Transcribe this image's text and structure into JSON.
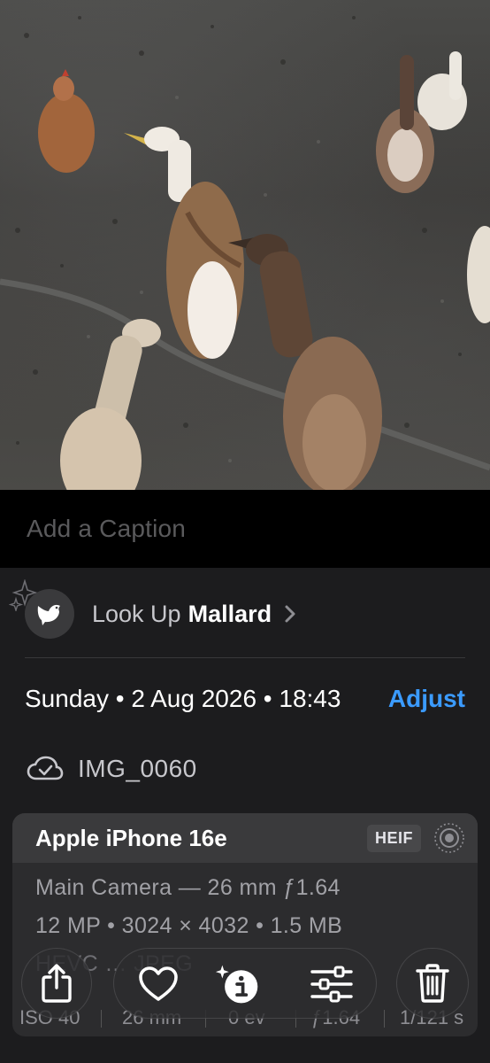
{
  "photo": {
    "subject": "ducks and a hen on gravel"
  },
  "caption": {
    "placeholder": "Add a Caption"
  },
  "lookup": {
    "label": "Look Up",
    "value": "Mallard",
    "icon": "bird-icon"
  },
  "date": {
    "text": "Sunday • 2 Aug 2026 • 18:43",
    "adjust_label": "Adjust"
  },
  "file": {
    "name": "IMG_0060",
    "icon": "cloud-check-icon"
  },
  "camera": {
    "device": "Apple iPhone 16e",
    "format_badge": "HEIF",
    "lens": "Main Camera — 26 mm ƒ1.64",
    "specs": "12 MP • 3024 × 4032 • 1.5 MB",
    "partial_line": "HEVC … JPEG",
    "exif": [
      "ISO 40",
      "26 mm",
      "0 ev",
      "ƒ1.64",
      "1/121 s"
    ]
  },
  "toolbar": {
    "share_icon": "share-icon",
    "favorite_icon": "heart-icon",
    "info_icon": "sparkle-info-icon",
    "adjust_icon": "sliders-icon",
    "delete_icon": "trash-icon"
  },
  "colors": {
    "accent": "#3b9bff",
    "panel": "#1c1c1e",
    "card": "#2c2c2e"
  }
}
